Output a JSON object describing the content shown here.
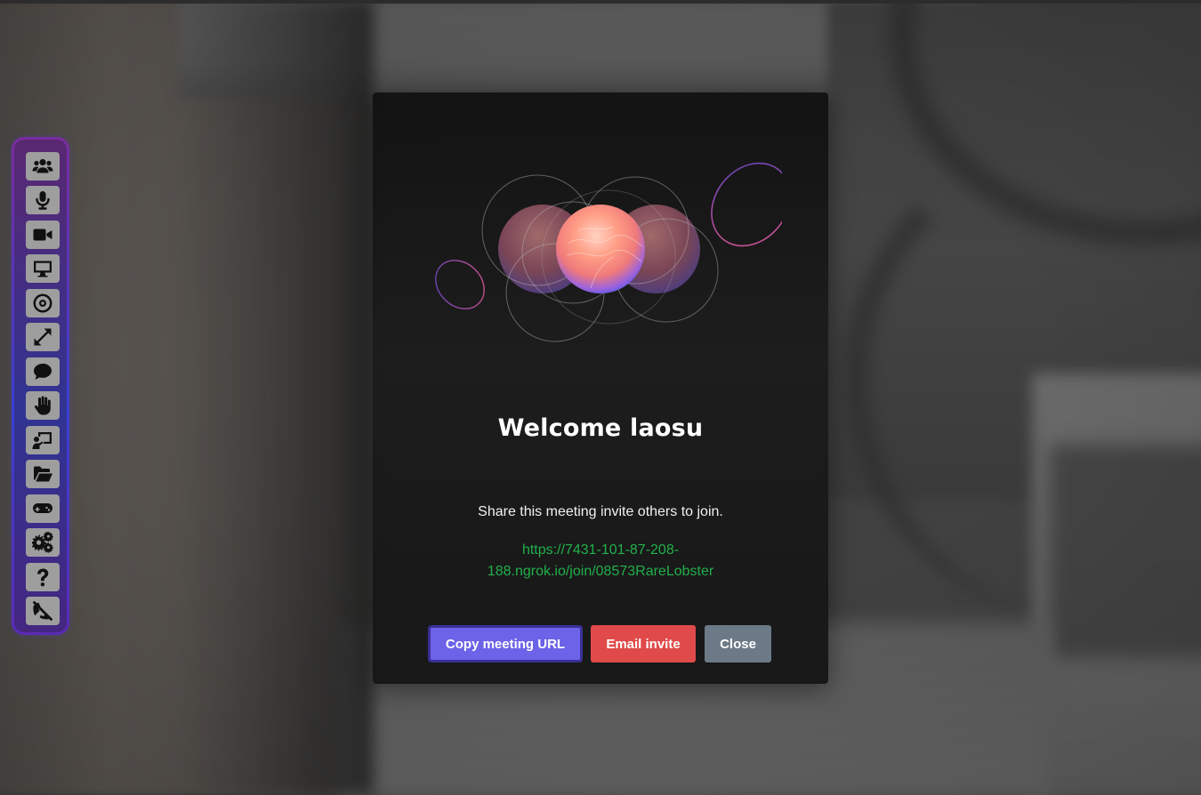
{
  "toolbar": {
    "items": [
      {
        "name": "participants-button",
        "icon": "users-icon"
      },
      {
        "name": "microphone-button",
        "icon": "microphone-icon"
      },
      {
        "name": "camera-button",
        "icon": "video-camera-icon"
      },
      {
        "name": "screen-share-button",
        "icon": "desktop-icon"
      },
      {
        "name": "record-button",
        "icon": "record-circle-icon"
      },
      {
        "name": "fullscreen-button",
        "icon": "expand-icon"
      },
      {
        "name": "chat-button",
        "icon": "chat-bubble-icon"
      },
      {
        "name": "raise-hand-button",
        "icon": "hand-icon"
      },
      {
        "name": "whiteboard-button",
        "icon": "chalkboard-user-icon"
      },
      {
        "name": "file-share-button",
        "icon": "folder-open-icon"
      },
      {
        "name": "games-button",
        "icon": "gamepad-icon"
      },
      {
        "name": "settings-button",
        "icon": "gears-icon"
      },
      {
        "name": "help-button",
        "icon": "question-icon"
      },
      {
        "name": "leave-button",
        "icon": "phone-slash-icon"
      }
    ],
    "border_colors": [
      "#7a2d9e",
      "#3a3fd1"
    ]
  },
  "modal": {
    "title": "Welcome laosu",
    "message": "Share this meeting invite others to join.",
    "url": "https://7431-101-87-208-188.ngrok.io/join/08573RareLobster",
    "buttons": {
      "copy": "Copy meeting URL",
      "email": "Email invite",
      "close": "Close"
    },
    "colors": {
      "copy": "#6c63e8",
      "email": "#e04a4a",
      "close": "#6b7a86",
      "url": "#21b04b"
    }
  }
}
